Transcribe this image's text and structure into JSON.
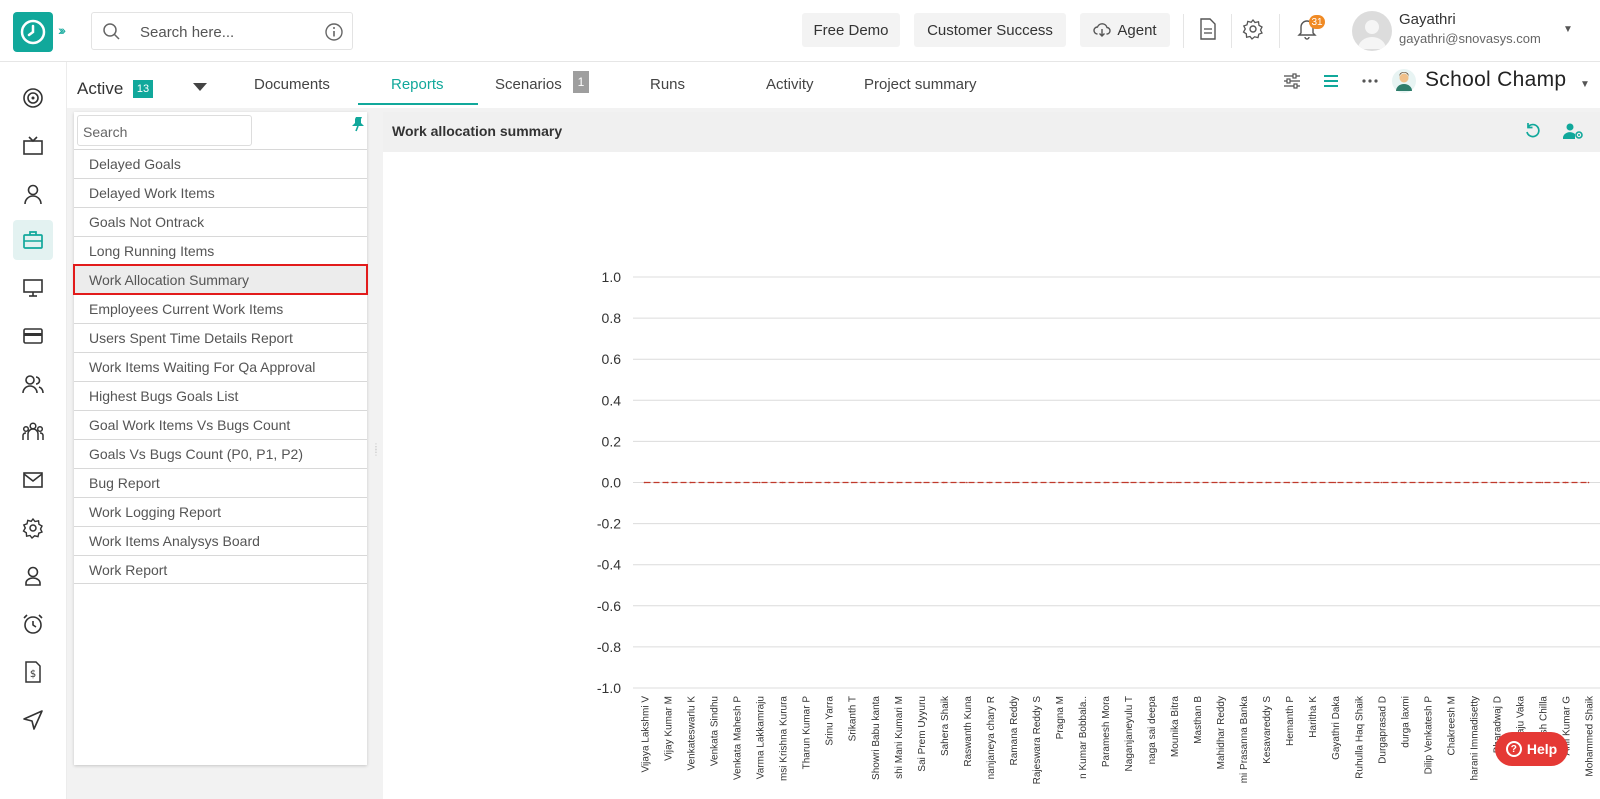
{
  "header": {
    "search_placeholder": "Search here...",
    "free_demo": "Free Demo",
    "customer_success": "Customer Success",
    "agent": "Agent",
    "notification_count": "31",
    "user_name": "Gayathri",
    "user_email": "gayathri@snovasys.com",
    "brand_color": "#11a89b"
  },
  "rail": {
    "items": [
      "target-icon",
      "tv-icon",
      "user-icon",
      "briefcase-icon",
      "monitor-icon",
      "card-icon",
      "users-icon",
      "team-icon",
      "mail-icon",
      "settings-icon",
      "person-icon",
      "alarm-icon",
      "invoice-icon",
      "send-icon"
    ],
    "active_index": 3
  },
  "tabs": {
    "active_label": "Active",
    "active_count": "13",
    "items": [
      "Documents",
      "Reports",
      "Scenarios",
      "Runs",
      "Activity",
      "Project summary"
    ],
    "selected": "Reports",
    "scenarios_badge": "1",
    "project_name": "School Champ"
  },
  "reports": {
    "search_placeholder": "Search",
    "items": [
      "Delayed Goals",
      "Delayed Work Items",
      "Goals Not Ontrack",
      "Long Running Items",
      "Work Allocation Summary",
      "Employees Current Work Items",
      "Users Spent Time Details Report",
      "Work Items Waiting For Qa Approval",
      "Highest Bugs Goals List",
      "Goal Work Items Vs Bugs Count",
      "Goals Vs Bugs Count (P0, P1, P2)",
      "Bug Report",
      "Work Logging Report",
      "Work Items Analysys Board",
      "Work Report"
    ],
    "selected_index": 4
  },
  "chart_panel": {
    "title": "Work allocation summary"
  },
  "chart_data": {
    "type": "line",
    "title": "",
    "xlabel": "",
    "ylabel": "",
    "ylim": [
      -1.0,
      1.0
    ],
    "y_ticks": [
      "1.0",
      "0.8",
      "0.6",
      "0.4",
      "0.2",
      "0.0",
      "-0.2",
      "-0.4",
      "-0.6",
      "-0.8",
      "-1.0"
    ],
    "categories": [
      "Vijaya Lakshmi V",
      "Vijay Kumar M",
      "Venkateswarlu K",
      "Venkata Sindhu",
      "Venkata Mahesh P",
      "Varma Lakkamraju",
      "msi Krishna Kurura",
      "Tharun Kumar P",
      "Srinu Yarra",
      "Srikanth T",
      "Showri Babu kanta",
      "shi Mani Kumari M",
      "Sai Prem Uyyuru",
      "Sahera Shaik",
      "Raswanth Kuna",
      "nanjaneya chary R",
      "Ramana Reddy",
      "Rajeswara Reddy S",
      "Pragna M",
      "n Kumar Bobbala..",
      "Paramesh Mora",
      "Naganjaneyulu T",
      "naga sai deepa",
      "Mounika Bitra",
      "Masthan B",
      "Mahidhar Reddy",
      "mi Prasanna Banka",
      "Kesavareddy S",
      "Hemanth P",
      "Haritha K",
      "Gayathri Daka",
      "Ruhulla Haq Shaik",
      "Durgaprasad D",
      "durga laxmi",
      "Dilip Venkatesh P",
      "Chakreesh M",
      "harani Immadisetty",
      "Bharadwaj D",
      "Arun Raju Vaka",
      "Anvesh Chilla",
      "Anil Kumar G",
      "Mohammed Shaik"
    ],
    "series": [
      {
        "values": [
          0,
          0,
          0,
          0,
          0,
          0,
          0,
          0,
          0,
          0,
          0,
          0,
          0,
          0,
          0,
          0,
          0,
          0,
          0,
          0,
          0,
          0,
          0,
          0,
          0,
          0,
          0,
          0,
          0,
          0,
          0,
          0,
          0,
          0,
          0,
          0,
          0,
          0,
          0,
          0,
          0,
          0
        ],
        "color": "#c0392b"
      }
    ],
    "grid": true,
    "legend": "none"
  },
  "help": {
    "label": "Help"
  }
}
